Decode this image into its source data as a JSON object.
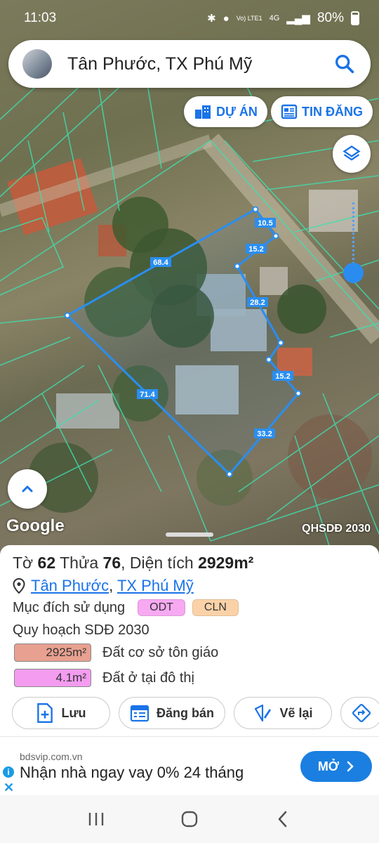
{
  "status_bar": {
    "time": "11:03",
    "network": "Vo) LTE1",
    "signal_label": "4G",
    "battery": "80%"
  },
  "search": {
    "title": "Tân Phước, TX Phú Mỹ"
  },
  "map_buttons": {
    "du_an": "DỰ ÁN",
    "tin_dang": "TIN ĐĂNG"
  },
  "map": {
    "brand": "Google",
    "overlay_label": "QHSDĐ 2030",
    "edge_labels": [
      "10.5",
      "15.2",
      "68.4",
      "28.2",
      "15.2",
      "71.4",
      "33.2"
    ]
  },
  "parcel": {
    "to_label": "Tờ",
    "to_value": "62",
    "thua_label": "Thửa",
    "thua_value": "76",
    "dien_tich_label": "Diện tích",
    "dien_tich_value": "2929m²",
    "location_part1": "Tân Phước",
    "location_sep": ",",
    "location_part2": "TX Phú Mỹ",
    "purpose_label": "Mục đích sử dụng",
    "tags": [
      {
        "label": "ODT",
        "color": "#f7a9f2"
      },
      {
        "label": "CLN",
        "color": "#fbd2a8"
      }
    ],
    "plan_label": "Quy hoạch SDĐ 2030",
    "areas": [
      {
        "value": "2925m²",
        "desc": "Đất cơ sở tôn giáo",
        "color": "#e8a090"
      },
      {
        "value": "4.1m²",
        "desc": "Đất ở tại đô thị",
        "color": "#f39cf0"
      }
    ]
  },
  "actions": {
    "save": "Lưu",
    "post": "Đăng bán",
    "redraw": "Vẽ lại"
  },
  "ad": {
    "source": "bdsvip.com.vn",
    "headline": "Nhận nhà ngay vay 0% 24 tháng",
    "cta": "MỞ"
  },
  "colors": {
    "accent": "#1a73e8",
    "parcel_line": "#2a8ef0"
  }
}
